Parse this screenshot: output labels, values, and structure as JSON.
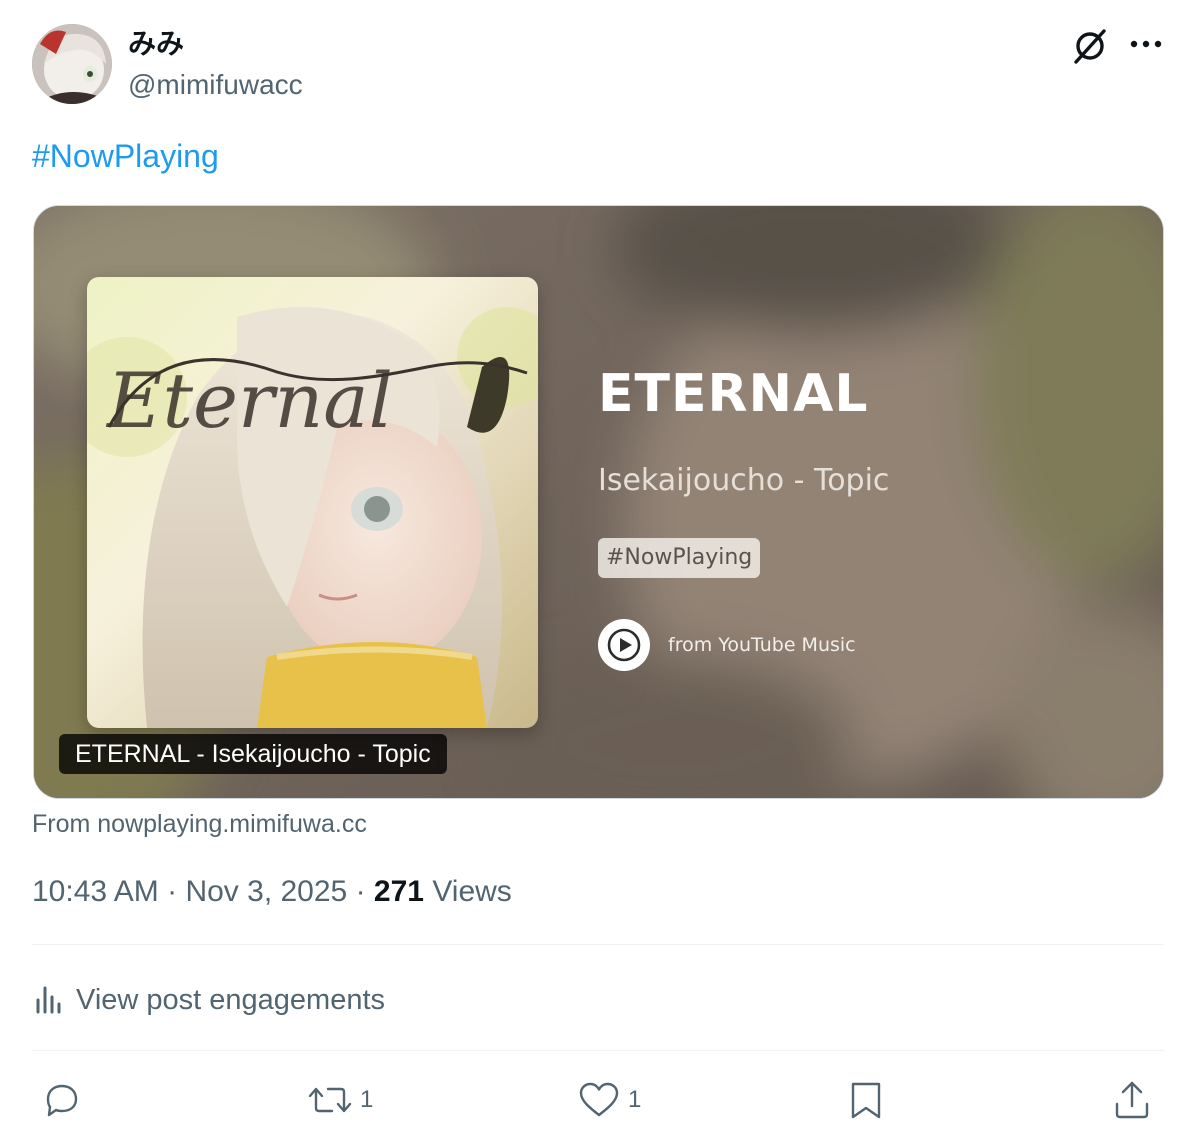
{
  "author": {
    "display_name": "みみ",
    "handle": "@mimifuwacc"
  },
  "post": {
    "text": "#NowPlaying"
  },
  "card": {
    "title": "ETERNAL",
    "artist": "Isekaijoucho - Topic",
    "tag": "#NowPlaying",
    "source_label": "from YouTube Music",
    "caption": "ETERNAL - Isekaijoucho - Topic",
    "cover_script_text": "Eternal"
  },
  "from_line": "From nowplaying.mimifuwa.cc",
  "meta": {
    "time": "10:43 AM",
    "separator": "·",
    "date": "Nov 3, 2025",
    "views_count": "271",
    "views_label": "Views"
  },
  "engagements_label": "View post engagements",
  "actions": {
    "reply_count": "",
    "repost_count": "1",
    "like_count": "1"
  },
  "colors": {
    "link": "#1d9bf0",
    "secondary_text": "#536471",
    "primary_text": "#0f1419"
  }
}
